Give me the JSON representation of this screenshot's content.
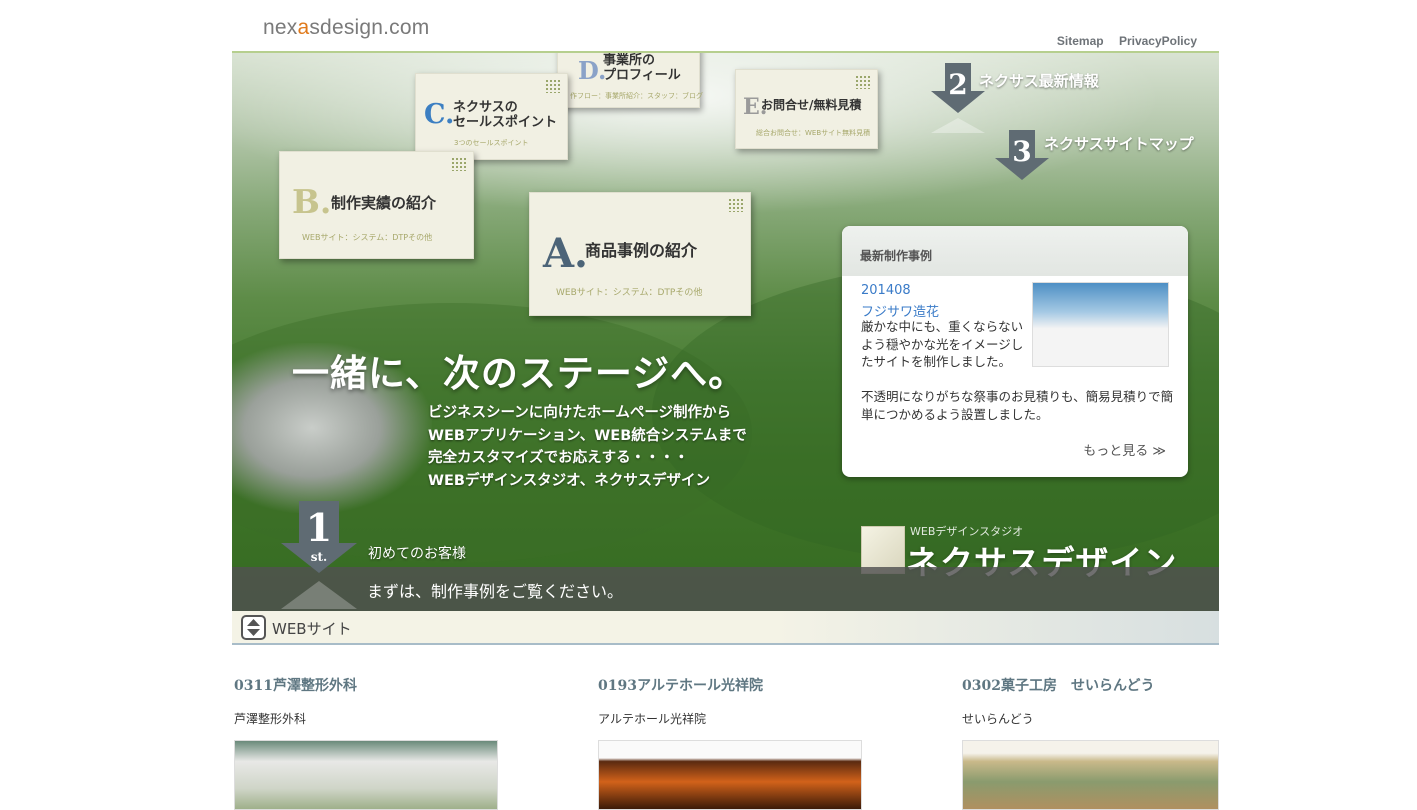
{
  "header": {
    "logo_pre": "nex",
    "logo_accent": "a",
    "logo_post": "sdesign.com",
    "links": [
      "Sitemap",
      "PrivacyPolicy"
    ]
  },
  "nav_cards": {
    "a": {
      "letter": "A.",
      "title": "商品事例の紹介",
      "sub": "WEBサイト：システム：DTPその他"
    },
    "b": {
      "letter": "B.",
      "title": "制作実績の紹介",
      "sub": "WEBサイト：システム：DTPその他"
    },
    "c": {
      "letter": "C.",
      "title": "ネクサスの\nセールスポイント",
      "sub": "3つのセールスポイント"
    },
    "d": {
      "letter": "D.",
      "title": "事業所の\nプロフィール",
      "sub": "作フロー：事業所紹介：スタッフ：ブログ"
    },
    "e": {
      "letter": "E.",
      "title": "お問合せ/無料見積",
      "sub": "総合お問合せ：WEBサイト無料見積"
    }
  },
  "steps": [
    {
      "number": "2",
      "label": "ネクサス最新情報"
    },
    {
      "number": "3",
      "label": "ネクサスサイトマップ"
    },
    {
      "number": "1",
      "suffix": "st.",
      "label": "初めてのお客様"
    }
  ],
  "hero": {
    "headline": "一緒に、次のステージへ。",
    "lead": [
      "ビジネスシーンに向けたホームページ制作から",
      "WEBアプリケーション、WEB統合システムまで",
      "完全カスタマイズでお応えする・・・・",
      "WEBデザインスタジオ、ネクサスデザイン"
    ],
    "bar_text": "まずは、制作事例をご覧ください。",
    "brand_sub": "WEBデザインスタジオ",
    "brand": "ネクサスデザイン"
  },
  "latest_works": {
    "title": "最新制作事例",
    "code": "201408",
    "name": "フジサワ造花",
    "desc": "厳かな中にも、重くならないよう穏やかな光をイメージしたサイトを制作しました。",
    "desc2": "不透明になりがちな祭事のお見積りも、簡易見積りで簡単につかめるよう設置しました。",
    "more": "もっと見る ≫"
  },
  "category": {
    "label": "WEBサイト"
  },
  "works": [
    {
      "title": "0311芦澤整形外科",
      "sub": "芦澤整形外科"
    },
    {
      "title": "0193アルテホール光祥院",
      "sub": "アルテホール光祥院"
    },
    {
      "title": "0302菓子工房　せいらんどう",
      "sub": "せいらんどう"
    }
  ],
  "colors": {
    "accent": "#e07a1c",
    "link": "#3a7bc8",
    "rule": "#b6cf8e"
  }
}
